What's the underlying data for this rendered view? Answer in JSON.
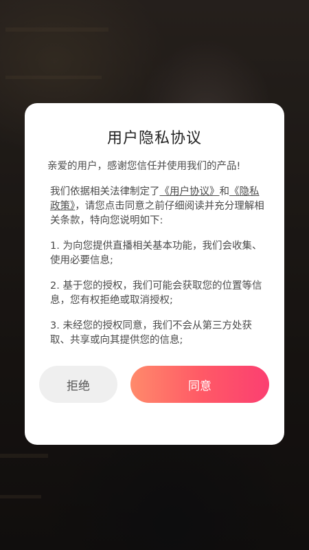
{
  "dialog": {
    "title": "用户隐私协议",
    "greeting": "亲爱的用户，感谢您信任并使用我们的产品!",
    "intro_prefix": "我们依据相关法律制定了",
    "link_user_agreement": "《用户协议》",
    "intro_and": "和",
    "link_privacy_policy": "《隐私政策》",
    "intro_suffix": "，请您点击同意之前仔细阅读并充分理解相关条款，特向您说明如下:",
    "item_1": "1. 为向您提供直播相关基本功能，我们会收集、使用必要信息;",
    "item_2": "2. 基于您的授权，我们可能会获取您的位置等信息，您有权拒绝或取消授权;",
    "item_3": "3. 未经您的授权同意，我们不会从第三方处获取、共享或向其提供您的信息;",
    "reject_label": "拒绝",
    "agree_label": "同意"
  },
  "colors": {
    "agree_gradient_start": "#ff8a6b",
    "agree_gradient_end": "#fb3f71",
    "reject_bg": "#efefef"
  }
}
